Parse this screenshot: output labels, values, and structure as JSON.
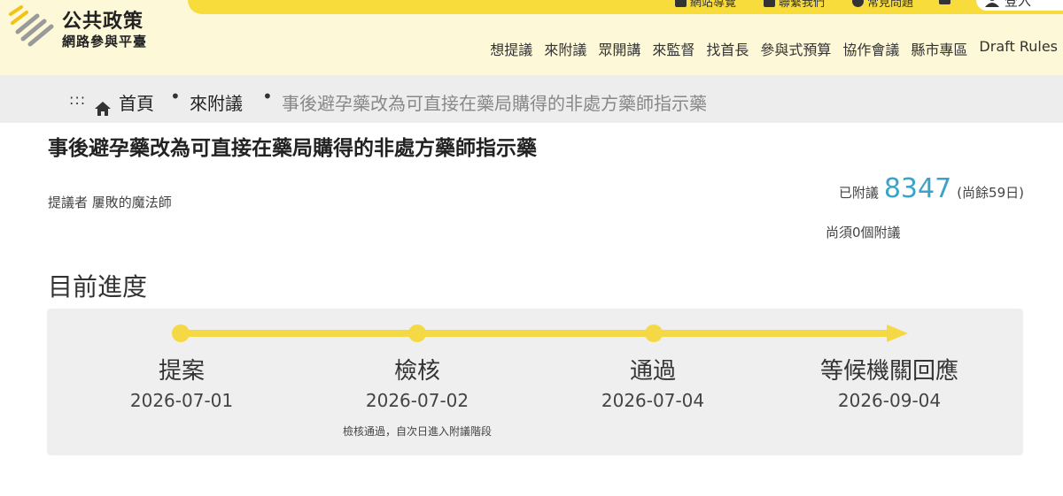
{
  "site": {
    "title": "公共政策",
    "subtitle": "網路參與平臺"
  },
  "topbar": {
    "links": [
      "網站導覽",
      "聯繫我們",
      "常見問題"
    ],
    "login_label": "登入"
  },
  "nav": {
    "items": [
      "想提議",
      "來附議",
      "眾開講",
      "來監督",
      "找首長",
      "參與式預算",
      "協作會議",
      "縣市專區",
      "Draft Rules"
    ]
  },
  "breadcrumb": {
    "menu_glyph": ":::",
    "home": "首頁",
    "section": "來附議",
    "current": "事後避孕藥改為可直接在藥局購得的非處方藥師指示藥",
    "separator": "•"
  },
  "proposal": {
    "title": "事後避孕藥改為可直接在藥局購得的非處方藥師指示藥",
    "proposer_label": "提議者",
    "proposer_name": "屢敗的魔法師",
    "signed_label": "已附議",
    "signed_count": "8347",
    "remaining_days": "(尚餘59日)",
    "needed": "尚須0個附議"
  },
  "progress": {
    "heading": "目前進度",
    "accent_color": "#f5d944",
    "steps": [
      {
        "label": "提案",
        "date": "2026-07-01",
        "note": ""
      },
      {
        "label": "檢核",
        "date": "2026-07-02",
        "note": "檢核通過，自次日進入附議階段"
      },
      {
        "label": "通過",
        "date": "2026-07-04",
        "note": ""
      },
      {
        "label": "等候機關回應",
        "date": "2026-09-04",
        "note": ""
      }
    ]
  }
}
